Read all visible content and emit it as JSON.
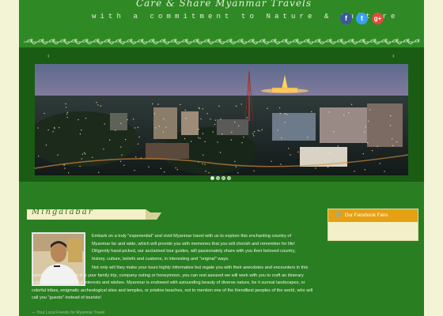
{
  "header": {
    "brand_line1": "Care & Share Myanmar Travels",
    "tagline": "with a commitment to Nature & Culture",
    "social": [
      {
        "name": "facebook-icon",
        "glyph": "f",
        "color": "#3b5998"
      },
      {
        "name": "twitter-icon",
        "glyph": "t",
        "color": "#38a1f3"
      },
      {
        "name": "google-plus-icon",
        "glyph": "g+",
        "color": "#dd4b39"
      }
    ]
  },
  "slider": {
    "prev_glyph": "‹",
    "next_glyph": "›",
    "slide_count": 4,
    "active_slide": 1
  },
  "main": {
    "page_title": "Mingalabar",
    "paragraph1": "Embark on a truly \"experiential\" and vivid Myanmar travel with us to explore this enchanting country of Myanmar far and wide, which will provide you with memories that you will cherish and remember for life! Diligently hand-picked, our acclaimed tour guides, will passionately share with you their beloved country, history, culture, beliefs and customs, in interesting and \"original\" ways.",
    "paragraph2": "Not only will they make your tours highly informative but regale you with their anecdotes and encounters in this mystic country. Whether it is your family trip, company outing or honeymoon, you can rest assured we will work with you to craft an itinerary tailored to your needs and interests and wishes. Myanmar is endowed with astounding beauty of diverse nature, be it surreal landscapes, or colorful tribes, enigmatic archeological sites and temples, or pristine beaches, not to mention one of the friendliest peoples of the world, who will call you \"guests\" instead of tourists!",
    "footnote": "— Your Local Friends for Myanmar Travel"
  },
  "sidebar": {
    "facebook_widget_title": "Our Facebook Fans",
    "facebook_icon_glyph": "🔗"
  },
  "colors": {
    "page_bg": "#f3f3d6",
    "content_green": "#207018",
    "header_green": "#2f8a26",
    "widget_orange": "#e6a013"
  }
}
